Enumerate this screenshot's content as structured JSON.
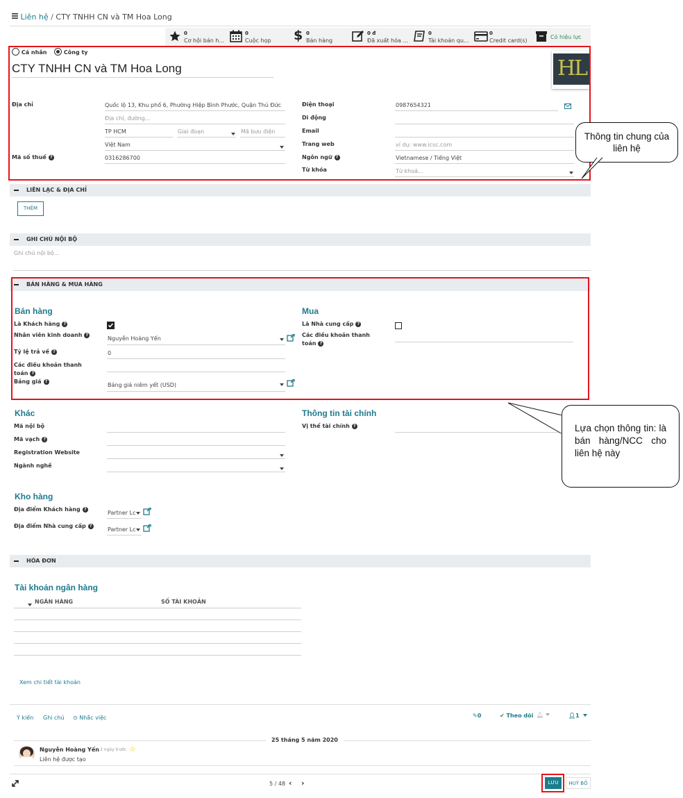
{
  "breadcrumb": {
    "parent": "Liên hệ",
    "separator": "/",
    "current": "CTY TNHH CN và TM Hoa Long"
  },
  "stats": [
    {
      "num": "0",
      "label": "Cơ hội bán h..."
    },
    {
      "num": "0",
      "label": "Cuộc họp"
    },
    {
      "num": "0",
      "label": "Bán hàng"
    },
    {
      "num": "0 đ",
      "label": "Đã xuất hóa ..."
    },
    {
      "num": "0",
      "label": "Tài khoản qu..."
    },
    {
      "num": "0",
      "label": "Credit card(s)"
    }
  ],
  "active_label": "Có hiệu lực",
  "company_type": {
    "individual": "Cá nhân",
    "company": "Công ty",
    "selected": "company"
  },
  "name": "CTY TNHH CN và TM Hoa Long",
  "logo_text": "HL",
  "address": {
    "label": "Địa chỉ",
    "street": "Quốc lộ 13, Khu phố 6, Phường Hiệp Bình Phước, Quận Thủ Đức",
    "street2_placeholder": "Địa chỉ, đường...",
    "city": "TP HCM",
    "state_placeholder": "Giai đoạn",
    "zip_placeholder": "Mã bưu điện",
    "country": "Việt Nam"
  },
  "tax": {
    "label": "Mã số thuế",
    "value": "0316286700"
  },
  "phone": {
    "label": "Điện thoại",
    "value": "0987654321"
  },
  "mobile": {
    "label": "Di động"
  },
  "email": {
    "label": "Email"
  },
  "website": {
    "label": "Trang web",
    "placeholder": "ví dụ: www.icsc.com"
  },
  "language": {
    "label": "Ngôn ngữ",
    "value": "Vietnamese / Tiếng Việt"
  },
  "tags": {
    "label": "Từ khóa",
    "placeholder": "Từ khoá..."
  },
  "sections": {
    "contacts": "LIÊN LẠC & ĐỊA CHỈ",
    "internal_notes": "GHI CHÚ NỘI BỘ",
    "sales_purchase": "BÁN HÀNG & MUA HÀNG",
    "invoicing": "HÓA ĐƠN"
  },
  "add_button": "THÊM",
  "notes_placeholder": "Ghi chú nội bộ...",
  "sales": {
    "title": "Bán hàng",
    "is_customer": "Là Khách hàng",
    "salesperson_label": "Nhân viên kinh doanh",
    "salesperson": "Nguyễn Hoàng Yến",
    "rebate_label": "Tỷ lệ trả về",
    "rebate": "0",
    "payment_terms_label1": "Các điều khoản thanh",
    "payment_terms_label2": "toán",
    "pricelist_label": "Bảng giá",
    "pricelist": "Bảng giá niêm yết (USD)"
  },
  "purchase": {
    "title": "Mua",
    "is_vendor": "Là Nhà cung cấp",
    "payment_terms_label1": "Các điều khoản thanh",
    "payment_terms_label2": "toán"
  },
  "misc": {
    "title": "Khác",
    "ref": "Mã nội bộ",
    "barcode": "Mã vạch",
    "website": "Registration Website",
    "industry": "Ngành nghề"
  },
  "fiscal": {
    "title": "Thông tin tài chính",
    "position": "Vị thế tài chính"
  },
  "inventory": {
    "title": "Kho hàng",
    "customer_loc": "Địa điểm Khách hàng",
    "customer_loc_value": "Partner Lc",
    "vendor_loc": "Địa điểm Nhà cung cấp",
    "vendor_loc_value": "Partner Lc"
  },
  "bank": {
    "title": "Tài khoản ngân hàng",
    "col_bank": "NGÂN HÀNG",
    "col_account": "SỐ TÀI KHOẢN",
    "details_link": "Xem chi tiết tài khoản"
  },
  "chatter": {
    "tabs": [
      "Ý kiến",
      "Ghi chú",
      "Nhắc việc"
    ],
    "attachments": "0",
    "follow": "Theo dõi",
    "followers": "1",
    "date": "25 tháng 5 năm 2020",
    "author": "Nguyễn Hoàng Yến",
    "when": "- 2 ngày trước",
    "message": "Liên hệ được tạo"
  },
  "pager": "5 / 48",
  "save_button": "LƯU",
  "discard_button": "HUỶ BỎ",
  "callouts": {
    "general": "Thông tin chung của liên hệ",
    "sales": "Lựa chọn thông tin: là bán hàng/NCC cho liên hệ này"
  },
  "colors": {
    "teal": "#1f7a8c",
    "highlight": "#e4131b",
    "save_bg": "#1a7d8c"
  }
}
